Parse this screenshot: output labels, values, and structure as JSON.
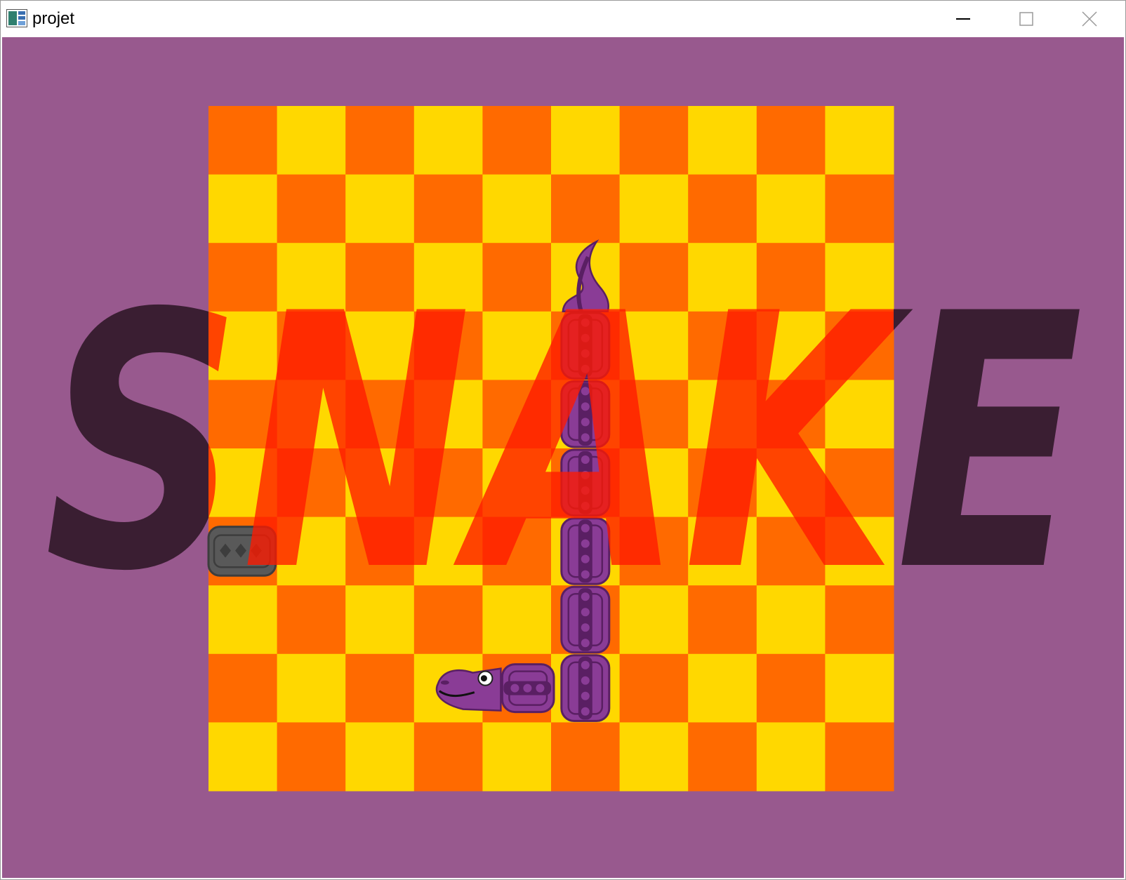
{
  "window": {
    "title": "projet",
    "app_icon": "window-app-icon",
    "controls": [
      {
        "name": "minimize",
        "icon": "minimize-icon"
      },
      {
        "name": "maximize",
        "icon": "maximize-icon"
      },
      {
        "name": "close",
        "icon": "close-icon"
      }
    ]
  },
  "colors": {
    "background": "#98598e",
    "tile_a": "#ff6a00",
    "tile_b": "#ffd800",
    "snake_body": "#8a3c96",
    "snake_dark": "#5a1f63",
    "title_dark": "#3a1e32",
    "title_red": "#ff1a00",
    "rock": "#595959"
  },
  "game": {
    "overlay_title": "SNAKE",
    "grid": {
      "cols": 10,
      "rows": 10
    },
    "snake": {
      "tail": {
        "col": 5,
        "row": 2
      },
      "body": [
        {
          "col": 5,
          "row": 3
        },
        {
          "col": 5,
          "row": 4
        },
        {
          "col": 5,
          "row": 5
        },
        {
          "col": 5,
          "row": 6
        },
        {
          "col": 5,
          "row": 7
        },
        {
          "col": 5,
          "row": 8
        }
      ],
      "corner": {
        "col": 4,
        "row": 8
      },
      "head": {
        "col": 3,
        "row": 8,
        "facing": "left"
      }
    },
    "obstacle": {
      "col": 0,
      "row": 6,
      "icon": "rock-icon"
    }
  }
}
